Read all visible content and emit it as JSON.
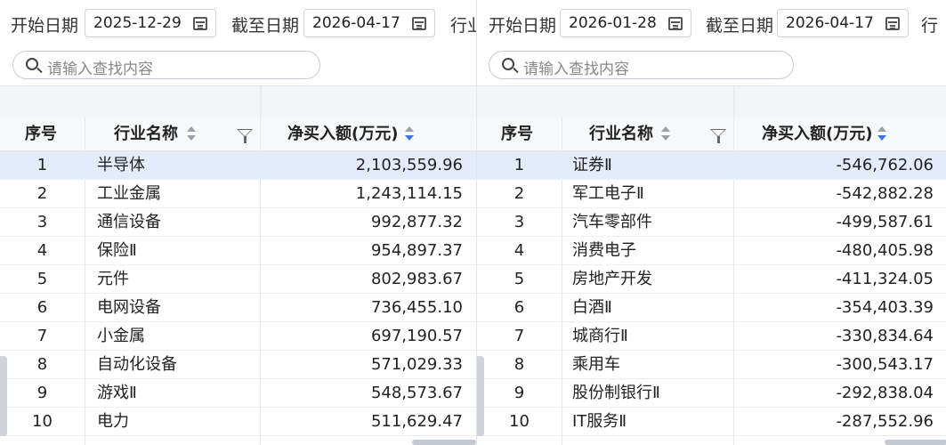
{
  "panels": [
    {
      "filters": {
        "start_label": "开始日期",
        "start_date": "2025-12-29",
        "end_label": "截至日期",
        "end_date": "2026-04-17",
        "industry_label_clipped": "行业"
      },
      "search": {
        "placeholder": "请输入查找内容"
      },
      "columns": {
        "index": "序号",
        "name": "行业名称",
        "value": "净买入额(万元)"
      },
      "sort": "desc",
      "rows": [
        {
          "index": "1",
          "name": "半导体",
          "value": "2,103,559.96"
        },
        {
          "index": "2",
          "name": "工业金属",
          "value": "1,243,114.15"
        },
        {
          "index": "3",
          "name": "通信设备",
          "value": "992,877.32"
        },
        {
          "index": "4",
          "name": "保险Ⅱ",
          "value": "954,897.37"
        },
        {
          "index": "5",
          "name": "元件",
          "value": "802,983.67"
        },
        {
          "index": "6",
          "name": "电网设备",
          "value": "736,455.10"
        },
        {
          "index": "7",
          "name": "小金属",
          "value": "697,190.57"
        },
        {
          "index": "8",
          "name": "自动化设备",
          "value": "571,029.33"
        },
        {
          "index": "9",
          "name": "游戏Ⅱ",
          "value": "548,573.67"
        },
        {
          "index": "10",
          "name": "电力",
          "value": "511,629.47"
        }
      ]
    },
    {
      "filters": {
        "start_label": "开始日期",
        "start_date": "2026-01-28",
        "end_label": "截至日期",
        "end_date": "2026-04-17",
        "industry_label_clipped": "行"
      },
      "search": {
        "placeholder": "请输入查找内容"
      },
      "columns": {
        "index": "序号",
        "name": "行业名称",
        "value": "净买入额(万元)"
      },
      "sort": "asc",
      "rows": [
        {
          "index": "1",
          "name": "证券Ⅱ",
          "value": "-546,762.06"
        },
        {
          "index": "2",
          "name": "军工电子Ⅱ",
          "value": "-542,882.28"
        },
        {
          "index": "3",
          "name": "汽车零部件",
          "value": "-499,587.61"
        },
        {
          "index": "4",
          "name": "消费电子",
          "value": "-480,405.98"
        },
        {
          "index": "5",
          "name": "房地产开发",
          "value": "-411,324.05"
        },
        {
          "index": "6",
          "name": "白酒Ⅱ",
          "value": "-354,403.39"
        },
        {
          "index": "7",
          "name": "城商行Ⅱ",
          "value": "-330,834.64"
        },
        {
          "index": "8",
          "name": "乘用车",
          "value": "-300,543.17"
        },
        {
          "index": "9",
          "name": "股份制银行Ⅱ",
          "value": "-292,838.04"
        },
        {
          "index": "10",
          "name": "IT服务Ⅱ",
          "value": "-287,552.96"
        }
      ]
    }
  ],
  "colors": {
    "selected_row": "#e4ecfb",
    "sort_active": "#3f74e0",
    "header_bg": "#f7f8fa"
  }
}
